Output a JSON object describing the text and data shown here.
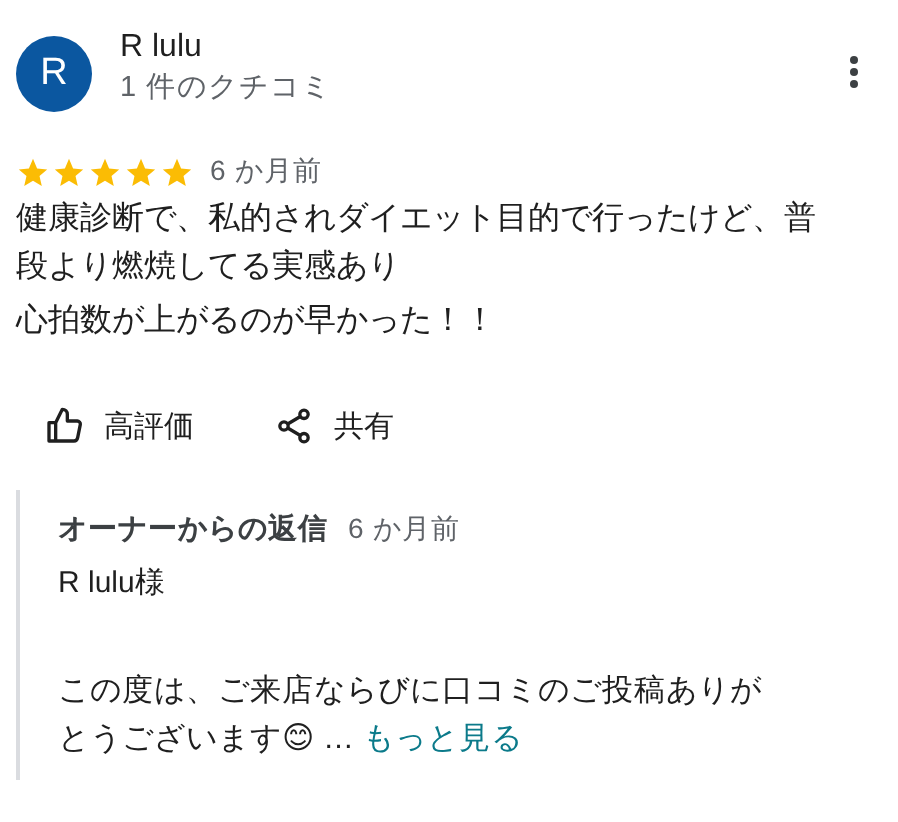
{
  "reviewer": {
    "initial": "R",
    "name": "R lulu",
    "review_count": "1 件のクチコミ"
  },
  "review": {
    "stars": 5,
    "time": "6 か月前",
    "lines": [
      "健康診断で、私的されダイエット目的で行ったけど、普段より燃焼してる実感あり",
      "心拍数が上がるのが早かった！！"
    ]
  },
  "actions": [
    {
      "kind": "like",
      "label": "高評価"
    },
    {
      "kind": "share",
      "label": "共有"
    }
  ],
  "owner_reply": {
    "title": "オーナーからの返信",
    "time": "6 か月前",
    "greeting": "R lulu様",
    "text": "この度は、ご来店ならびに口コミのご投稿ありがとうございます😊 …",
    "more_link": "もっと見る"
  }
}
